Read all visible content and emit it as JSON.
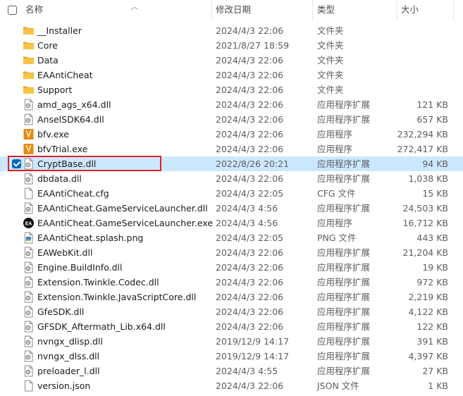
{
  "header": {
    "name": "名称",
    "date": "修改日期",
    "type": "类型",
    "size": "大小"
  },
  "colors": {
    "folder": "#f7c447",
    "selected_row": "#cce8ff",
    "highlight": "#e0202a",
    "checkbox_checked": "#0067c0"
  },
  "files": [
    {
      "name": "__Installer",
      "date": "2024/4/3 22:06",
      "type": "文件夹",
      "size": "",
      "icon": "folder-icon"
    },
    {
      "name": "Core",
      "date": "2021/8/27 18:59",
      "type": "文件夹",
      "size": "",
      "icon": "folder-icon"
    },
    {
      "name": "Data",
      "date": "2024/4/3 22:06",
      "type": "文件夹",
      "size": "",
      "icon": "folder-icon"
    },
    {
      "name": "EAAntiCheat",
      "date": "2024/4/3 22:06",
      "type": "文件夹",
      "size": "",
      "icon": "folder-icon"
    },
    {
      "name": "Support",
      "date": "2024/4/3 22:06",
      "type": "文件夹",
      "size": "",
      "icon": "folder-icon"
    },
    {
      "name": "amd_ags_x64.dll",
      "date": "2024/4/3 22:06",
      "type": "应用程序扩展",
      "size": "121 KB",
      "icon": "dll-icon"
    },
    {
      "name": "AnselSDK64.dll",
      "date": "2024/4/3 22:06",
      "type": "应用程序扩展",
      "size": "657 KB",
      "icon": "dll-icon"
    },
    {
      "name": "bfv.exe",
      "date": "2024/4/3 22:06",
      "type": "应用程序",
      "size": "232,294 KB",
      "icon": "bfv-exe-icon"
    },
    {
      "name": "bfvTrial.exe",
      "date": "2024/4/3 22:06",
      "type": "应用程序",
      "size": "272,417 KB",
      "icon": "bfv-exe-icon"
    },
    {
      "name": "CryptBase.dll",
      "date": "2022/8/26 20:21",
      "type": "应用程序扩展",
      "size": "94 KB",
      "icon": "dll-icon",
      "selected": true
    },
    {
      "name": "dbdata.dll",
      "date": "2024/4/3 22:06",
      "type": "应用程序扩展",
      "size": "1,038 KB",
      "icon": "dll-icon"
    },
    {
      "name": "EAAntiCheat.cfg",
      "date": "2024/4/3 22:05",
      "type": "CFG 文件",
      "size": "15 KB",
      "icon": "file-icon"
    },
    {
      "name": "EAAntiCheat.GameServiceLauncher.dll",
      "date": "2024/4/3 4:56",
      "type": "应用程序扩展",
      "size": "24,503 KB",
      "icon": "dll-icon"
    },
    {
      "name": "EAAntiCheat.GameServiceLauncher.exe",
      "date": "2024/4/3 4:56",
      "type": "应用程序",
      "size": "16,712 KB",
      "icon": "ea-exe-icon"
    },
    {
      "name": "EAAntiCheat.splash.png",
      "date": "2024/4/3 22:05",
      "type": "PNG 文件",
      "size": "443 KB",
      "icon": "png-icon"
    },
    {
      "name": "EAWebKit.dll",
      "date": "2024/4/3 22:06",
      "type": "应用程序扩展",
      "size": "21,204 KB",
      "icon": "dll-icon"
    },
    {
      "name": "Engine.BuildInfo.dll",
      "date": "2024/4/3 22:06",
      "type": "应用程序扩展",
      "size": "19 KB",
      "icon": "dll-icon"
    },
    {
      "name": "Extension.Twinkle.Codec.dll",
      "date": "2024/4/3 22:06",
      "type": "应用程序扩展",
      "size": "972 KB",
      "icon": "dll-icon"
    },
    {
      "name": "Extension.Twinkle.JavaScriptCore.dll",
      "date": "2024/4/3 22:06",
      "type": "应用程序扩展",
      "size": "2,219 KB",
      "icon": "dll-icon"
    },
    {
      "name": "GfeSDK.dll",
      "date": "2024/4/3 22:06",
      "type": "应用程序扩展",
      "size": "4,122 KB",
      "icon": "dll-icon"
    },
    {
      "name": "GFSDK_Aftermath_Lib.x64.dll",
      "date": "2024/4/3 22:06",
      "type": "应用程序扩展",
      "size": "122 KB",
      "icon": "dll-icon"
    },
    {
      "name": "nvngx_dlisp.dll",
      "date": "2019/12/9 14:17",
      "type": "应用程序扩展",
      "size": "391 KB",
      "icon": "dll-icon"
    },
    {
      "name": "nvngx_dlss.dll",
      "date": "2019/12/9 14:17",
      "type": "应用程序扩展",
      "size": "4,397 KB",
      "icon": "dll-icon"
    },
    {
      "name": "preloader_l.dll",
      "date": "2024/4/3 4:55",
      "type": "应用程序扩展",
      "size": "27 KB",
      "icon": "dll-icon"
    },
    {
      "name": "version.json",
      "date": "2024/4/3 22:06",
      "type": "JSON 文件",
      "size": "1 KB",
      "icon": "file-icon"
    }
  ]
}
